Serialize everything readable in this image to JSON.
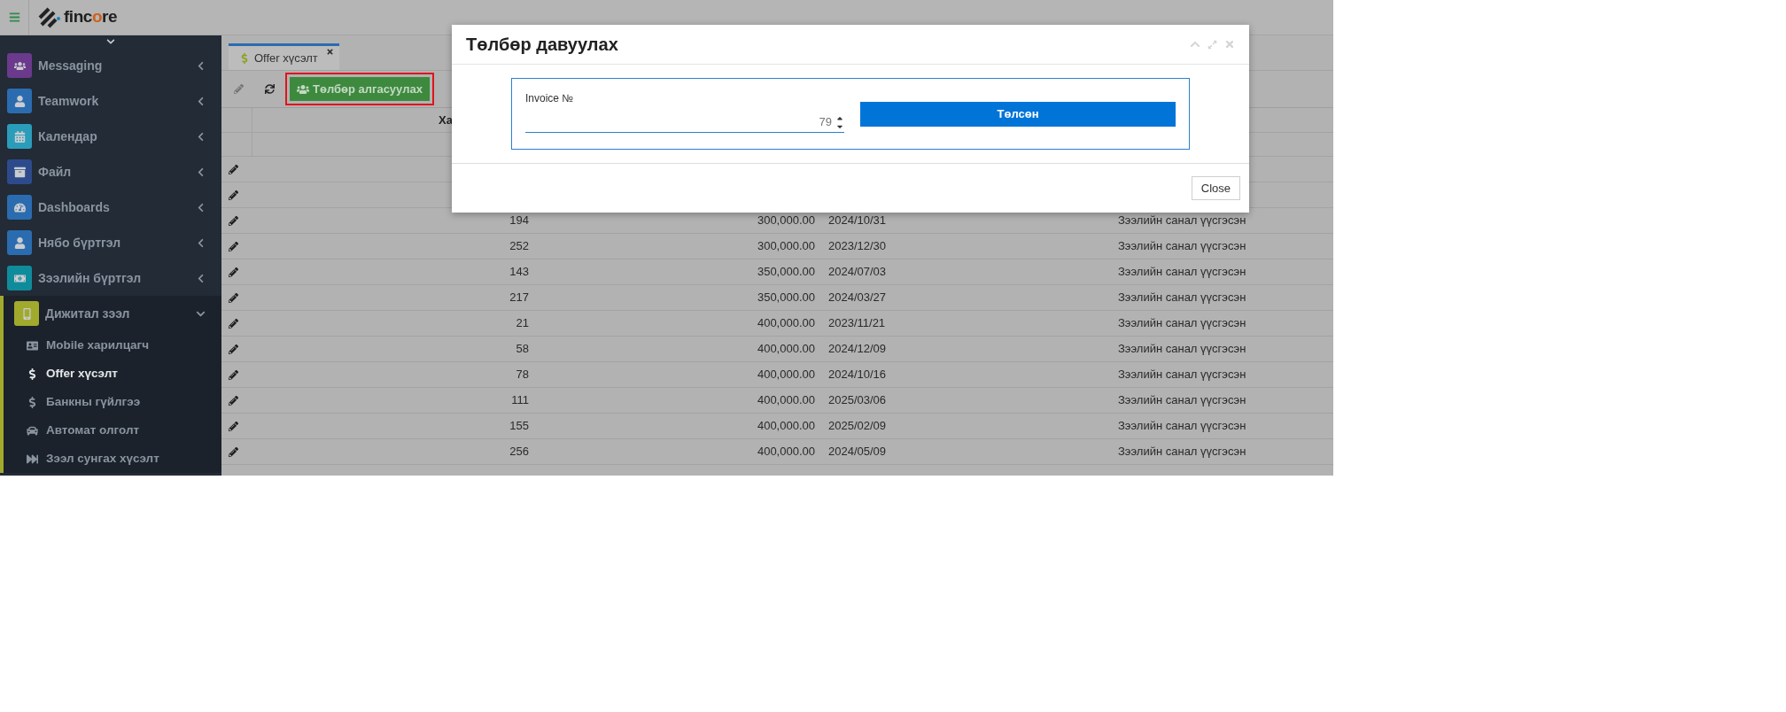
{
  "header": {
    "logo": {
      "before": "finc",
      "accent": "o",
      "after": "re"
    }
  },
  "sidebar": {
    "items": [
      {
        "kind": "group",
        "label": "Messaging",
        "color": "#6b3a8c",
        "expanded": false
      },
      {
        "kind": "group",
        "label": "Teamwork",
        "color": "#2b6cb0",
        "expanded": false
      },
      {
        "kind": "group",
        "label": "Календар",
        "color": "#2a9dbb",
        "expanded": false
      },
      {
        "kind": "group",
        "label": "Файл",
        "color": "#2d4b8c",
        "expanded": false
      },
      {
        "kind": "group",
        "label": "Dashboards",
        "color": "#2b6cb0",
        "expanded": false
      },
      {
        "kind": "group",
        "label": "Нябо бүртгэл",
        "color": "#2b6cb0",
        "expanded": false
      },
      {
        "kind": "group",
        "label": "Зээлийн бүртгэл",
        "color": "#0f8c9c",
        "expanded": false
      },
      {
        "kind": "group",
        "label": "Дижитал зээл",
        "color": "#a2aa2e",
        "expanded": true,
        "children": [
          {
            "label": "Mobile харилцагч",
            "selected": false
          },
          {
            "label": "Offer хүсэлт",
            "selected": true
          },
          {
            "label": "Банкны гүйлгээ",
            "selected": false
          },
          {
            "label": "Автомат олголт",
            "selected": false
          },
          {
            "label": "Зээл сунгах хүсэлт",
            "selected": false
          }
        ]
      }
    ]
  },
  "tabs": [
    {
      "label": "Offer хүсэлт",
      "selected": true
    }
  ],
  "toolbar": {
    "primary_button": "Төлбөр алгасуулах",
    "highlighted": true
  },
  "table": {
    "columns": [
      "Ха"
    ],
    "rows": [
      {
        "kind": "covered"
      },
      {
        "kind": "covered"
      },
      {
        "kind": "data",
        "number": "194",
        "amount": "300,000.00",
        "date": "2024/10/31",
        "status": "Зээлийн санал үүсгэсэн"
      },
      {
        "kind": "data",
        "number": "252",
        "amount": "300,000.00",
        "date": "2023/12/30",
        "status": "Зээлийн санал үүсгэсэн"
      },
      {
        "kind": "data",
        "number": "143",
        "amount": "350,000.00",
        "date": "2024/07/03",
        "status": "Зээлийн санал үүсгэсэн"
      },
      {
        "kind": "data",
        "number": "217",
        "amount": "350,000.00",
        "date": "2024/03/27",
        "status": "Зээлийн санал үүсгэсэн"
      },
      {
        "kind": "data",
        "number": "21",
        "amount": "400,000.00",
        "date": "2023/11/21",
        "status": "Зээлийн санал үүсгэсэн"
      },
      {
        "kind": "data",
        "number": "58",
        "amount": "400,000.00",
        "date": "2024/12/09",
        "status": "Зээлийн санал үүсгэсэн"
      },
      {
        "kind": "data",
        "number": "78",
        "amount": "400,000.00",
        "date": "2024/10/16",
        "status": "Зээлийн санал үүсгэсэн"
      },
      {
        "kind": "data",
        "number": "111",
        "amount": "400,000.00",
        "date": "2025/03/06",
        "status": "Зээлийн санал үүсгэсэн"
      },
      {
        "kind": "data",
        "number": "155",
        "amount": "400,000.00",
        "date": "2025/02/09",
        "status": "Зээлийн санал үүсгэсэн"
      },
      {
        "kind": "data",
        "number": "256",
        "amount": "400,000.00",
        "date": "2024/05/09",
        "status": "Зээлийн санал үүсгэсэн"
      }
    ]
  },
  "dialog": {
    "title": "Төлбөр давуулах",
    "field_label": "Invoice №",
    "field_value": "79",
    "submit_button": "Төлсөн",
    "close_button": "Close"
  }
}
